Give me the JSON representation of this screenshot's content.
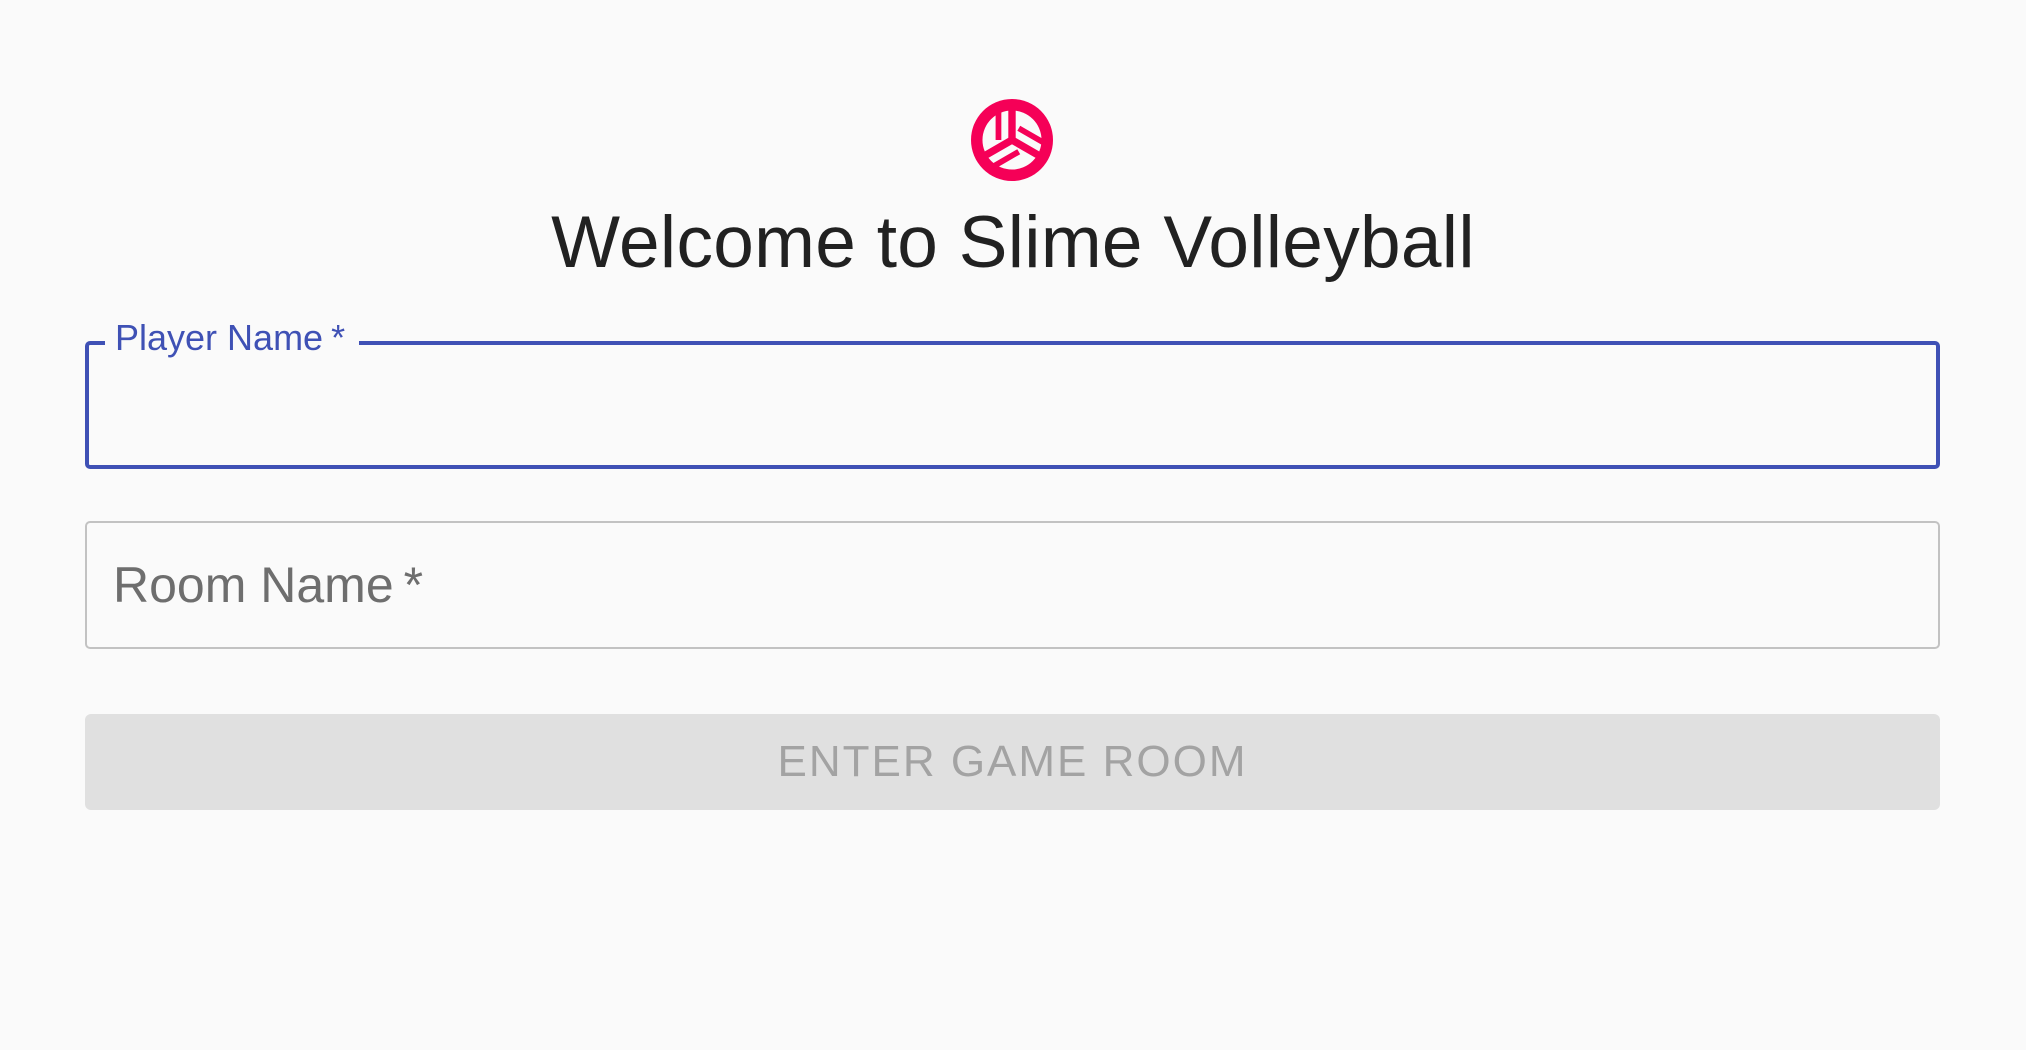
{
  "logo": {
    "icon": "volleyball-icon",
    "color": "#f50057"
  },
  "title": "Welcome to Slime Volleyball",
  "form": {
    "player_name": {
      "label": "Player Name",
      "required_mark": "*",
      "value": "",
      "state": "focused"
    },
    "room_name": {
      "label": "Room Name",
      "required_mark": "*",
      "value": ""
    },
    "submit": {
      "label": "ENTER GAME ROOM",
      "enabled": false
    }
  },
  "colors": {
    "accent": "#3f51b5",
    "brand": "#f50057",
    "background": "#fafafa",
    "disabled_button_bg": "#e0e0e0",
    "disabled_button_text": "#a3a3a3"
  }
}
